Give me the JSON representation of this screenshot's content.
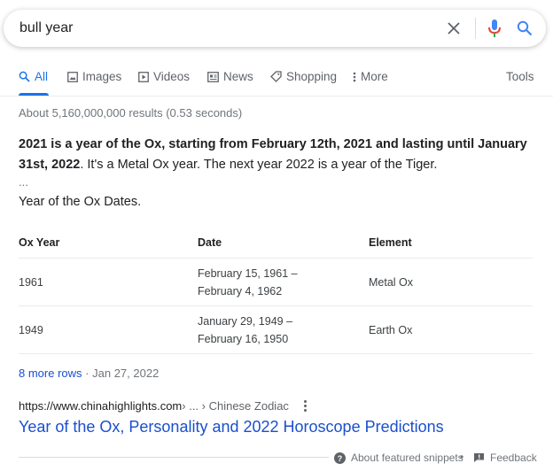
{
  "search": {
    "query": "bull year"
  },
  "tabs": [
    {
      "label": "All",
      "icon": "search-icon",
      "active": true
    },
    {
      "label": "Images",
      "icon": "image-icon"
    },
    {
      "label": "Videos",
      "icon": "video-icon"
    },
    {
      "label": "News",
      "icon": "news-icon"
    },
    {
      "label": "Shopping",
      "icon": "tag-icon"
    },
    {
      "label": "More",
      "icon": "more-vert-icon"
    }
  ],
  "tools_label": "Tools",
  "stats": "About 5,160,000,000 results (0.53 seconds)",
  "snippet": {
    "bold": "2021 is a year of the Ox, starting from February 12th, 2021 and lasting until January 31st, 2022",
    "rest": ". It's a Metal Ox year. The next year 2022 is a year of the Tiger.",
    "ellipsis": "...",
    "subtitle": "Year of the Ox Dates."
  },
  "table": {
    "headers": [
      "Ox Year",
      "Date",
      "Element"
    ],
    "rows": [
      {
        "year": "1961",
        "date": "February 15, 1961 – February 4, 1962",
        "element": "Metal Ox"
      },
      {
        "year": "1949",
        "date": "January 29, 1949 – February 16, 1950",
        "element": "Earth Ox"
      }
    ]
  },
  "more_rows": {
    "link": "8 more rows",
    "sep": "·",
    "date": "Jan 27, 2022"
  },
  "result": {
    "url": "https://www.chinahighlights.com",
    "crumb": " › ... › Chinese Zodiac",
    "title": "Year of the Ox, Personality and 2022 Horoscope Predictions"
  },
  "footer": {
    "about": "About featured snippets",
    "sep": "•",
    "feedback": "Feedback"
  },
  "colors": {
    "link": "#1a4fcf",
    "accent": "#1a73e8",
    "mic_blue": "#4285f4",
    "mic_red": "#ea4335"
  }
}
